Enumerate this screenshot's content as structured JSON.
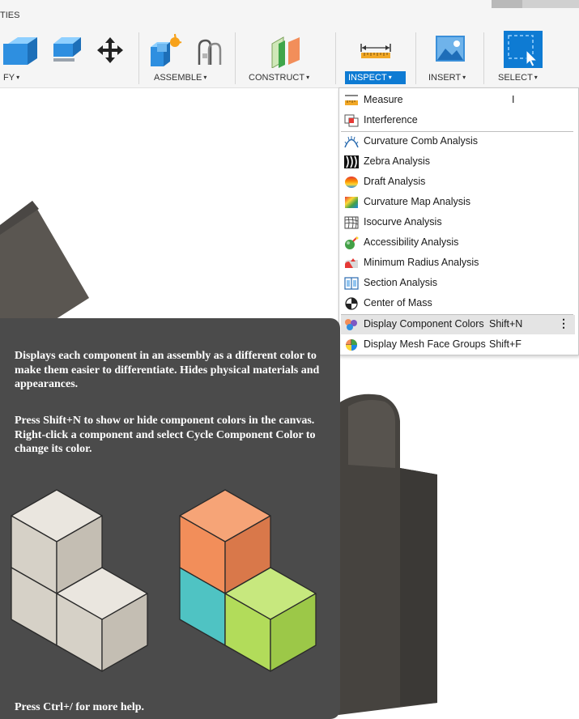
{
  "toolbar": {
    "top_strip_label": "TIES",
    "groups": [
      {
        "label": "FY",
        "active": false
      },
      {
        "label": "ASSEMBLE",
        "active": false
      },
      {
        "label": "CONSTRUCT",
        "active": false
      },
      {
        "label": "INSPECT",
        "active": true
      },
      {
        "label": "INSERT",
        "active": false
      },
      {
        "label": "SELECT",
        "active": false
      }
    ],
    "caret": "▾",
    "icons": [
      "box-extrude-icon",
      "shell-icon",
      "move-icon",
      "new-component-icon",
      "joint-icon",
      "offset-plane-icon",
      "measure-ruler-icon",
      "insert-image-icon",
      "select-window-icon"
    ]
  },
  "menu": {
    "items": [
      {
        "label": "Measure",
        "shortcut": "I",
        "icon": "measure-icon"
      },
      {
        "label": "Interference",
        "shortcut": "",
        "icon": "interference-icon"
      },
      {
        "label": "Curvature Comb Analysis",
        "shortcut": "",
        "icon": "curvature-comb-icon"
      },
      {
        "label": "Zebra Analysis",
        "shortcut": "",
        "icon": "zebra-icon"
      },
      {
        "label": "Draft Analysis",
        "shortcut": "",
        "icon": "draft-analysis-icon"
      },
      {
        "label": "Curvature Map Analysis",
        "shortcut": "",
        "icon": "curvature-map-icon"
      },
      {
        "label": "Isocurve Analysis",
        "shortcut": "",
        "icon": "isocurve-icon"
      },
      {
        "label": "Accessibility Analysis",
        "shortcut": "",
        "icon": "accessibility-analysis-icon"
      },
      {
        "label": "Minimum Radius Analysis",
        "shortcut": "",
        "icon": "minimum-radius-icon"
      },
      {
        "label": "Section Analysis",
        "shortcut": "",
        "icon": "section-analysis-icon"
      },
      {
        "label": "Center of Mass",
        "shortcut": "",
        "icon": "center-of-mass-icon"
      },
      {
        "label": "Display Component Colors",
        "shortcut": "Shift+N",
        "icon": "component-colors-icon",
        "highlighted": true
      },
      {
        "label": "Display Mesh Face Groups",
        "shortcut": "Shift+F",
        "icon": "mesh-face-groups-icon"
      }
    ],
    "more_glyph": "⋮"
  },
  "tooltip": {
    "paragraph1": "Displays each component in an assembly as a different color to make them easier to differentiate. Hides physical materials and appearances.",
    "paragraph2": "Press Shift+N to show or hide component colors in the canvas. Right-click a component and select Cycle Component Color to change its color.",
    "help": "Press Ctrl+/ for more help."
  },
  "colors": {
    "accent": "#0e7bd3",
    "tooltip_bg": "#4b4b4b",
    "cube_orange": "#f28e5a",
    "cube_teal": "#4fc3c3",
    "cube_green": "#b2dc5a",
    "cube_beige": "#ddd8cf"
  }
}
